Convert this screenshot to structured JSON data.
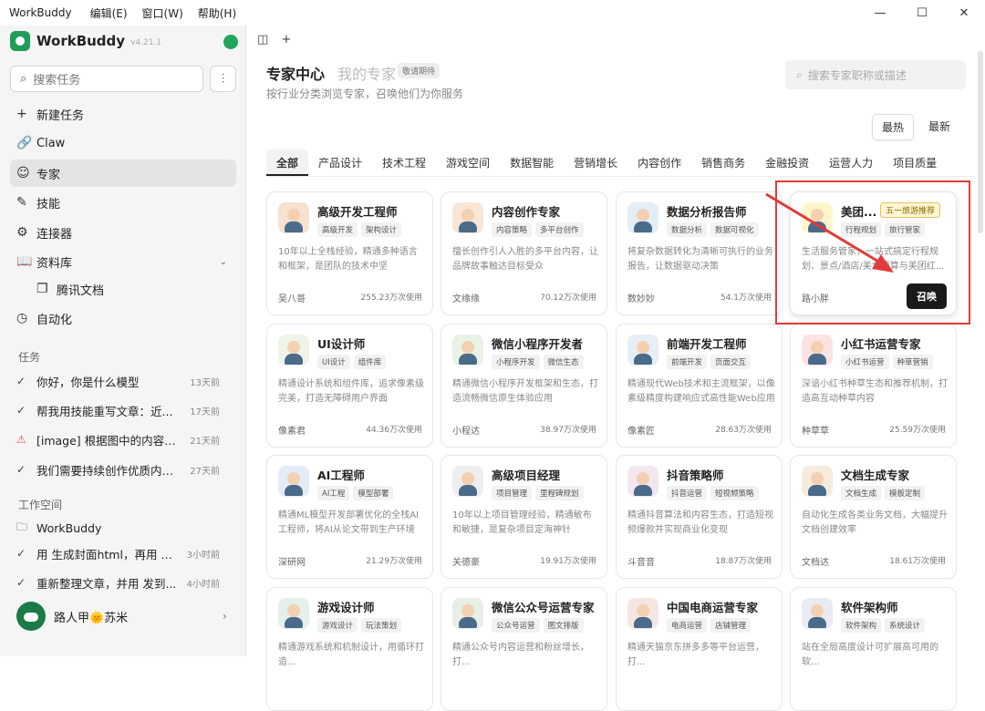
{
  "menubar": {
    "app": "WorkBuddy",
    "items": [
      "编辑(E)",
      "窗口(W)",
      "帮助(H)"
    ]
  },
  "window": {
    "min": "—",
    "max": "☐",
    "close": "✕"
  },
  "sidebar": {
    "brand": "WorkBuddy",
    "version": "v4.21.1",
    "search_placeholder": "搜索任务",
    "nav": [
      {
        "label": "新建任务",
        "icon": "+"
      },
      {
        "label": "Claw",
        "icon": "🔗"
      },
      {
        "label": "专家",
        "icon": "☺"
      },
      {
        "label": "技能",
        "icon": "✎"
      },
      {
        "label": "连接器",
        "icon": "⚙"
      },
      {
        "label": "资料库",
        "icon": "📖"
      },
      {
        "label": "腾讯文档",
        "icon": "❐"
      },
      {
        "label": "自动化",
        "icon": "◷"
      }
    ],
    "tasks_title": "任务",
    "tasks": [
      {
        "text": "你好，你是什么模型",
        "time": "13天前",
        "icon": "✓"
      },
      {
        "text": "帮我用技能重写文章：近...",
        "time": "17天前",
        "icon": "✓"
      },
      {
        "text": "[image] 根据图中的内容排...",
        "time": "21天前",
        "icon": "⚠"
      },
      {
        "text": "我们需要持续创作优质内容...",
        "time": "27天前",
        "icon": "✓"
      }
    ],
    "workspace_title": "工作空间",
    "workspace_folder": "WorkBuddy",
    "workspace_tasks": [
      {
        "text": "用 生成封面html，再用 转...",
        "time": "3小时前"
      },
      {
        "text": "重新整理文章，并用 发到...",
        "time": "4小时前"
      }
    ],
    "user": "路人甲🌞苏米"
  },
  "main": {
    "title": "专家中心",
    "title2": "我的专家",
    "soon": "敬请期待",
    "subtitle": "按行业分类浏览专家，召唤他们为你服务",
    "search_placeholder": "搜索专家职称或描述",
    "sort": [
      "最热",
      "最新"
    ],
    "categories": [
      "全部",
      "产品设计",
      "技术工程",
      "游戏空间",
      "数据智能",
      "营销增长",
      "内容创作",
      "销售商务",
      "金融投资",
      "运营人力",
      "项目质量"
    ],
    "summon_label": "召唤",
    "cards": [
      {
        "name": "高级开发工程师",
        "tags": [
          "高级开发",
          "架构设计"
        ],
        "desc": "10年以上全栈经验，精通多种语言和框架，是团队的技术中坚",
        "author": "吴八哥",
        "uses": "255.23万次使用",
        "color": "#f6e2cf"
      },
      {
        "name": "内容创作专家",
        "tags": [
          "内容策略",
          "多平台创作"
        ],
        "desc": "擅长创作引人入胜的多平台内容，让品牌故事触达目标受众",
        "author": "文缘缘",
        "uses": "70.12万次使用",
        "color": "#f8e6d6"
      },
      {
        "name": "数据分析报告师",
        "tags": [
          "数据分析",
          "数据可视化"
        ],
        "desc": "将复杂数据转化为清晰可执行的业务报告，让数据驱动决策",
        "author": "数妙妙",
        "uses": "54.1万次使用",
        "color": "#e3eef6"
      },
      {
        "name": "美团...",
        "tags": [
          "行程规划",
          "旅行管家"
        ],
        "badge": "五一旅游推荐",
        "desc": "生活服务管家，一站式搞定行程规划、景点/酒店/美食预算与美团红...",
        "author": "路小胖",
        "uses": "",
        "color": "#fff6cc",
        "summon": true
      },
      {
        "name": "UI设计师",
        "tags": [
          "UI设计",
          "组件库"
        ],
        "desc": "精通设计系统和组件库，追求像素级完美，打造无障碍用户界面",
        "author": "像素君",
        "uses": "44.36万次使用",
        "color": "#eef4e8"
      },
      {
        "name": "微信小程序开发者",
        "tags": [
          "小程序开发",
          "微信生态"
        ],
        "desc": "精通微信小程序开发框架和生态，打造流畅微信原生体验应用",
        "author": "小程达",
        "uses": "38.97万次使用",
        "color": "#e8f3e6"
      },
      {
        "name": "前端开发工程师",
        "tags": [
          "前端开发",
          "页面交互"
        ],
        "desc": "精通现代Web技术和主流框架，以像素级精度构建响应式高性能Web应用",
        "author": "像素匠",
        "uses": "28.63万次使用",
        "color": "#e6eef6"
      },
      {
        "name": "小红书运营专家",
        "tags": [
          "小红书运营",
          "种草营销"
        ],
        "desc": "深谙小红书种草生态和推荐机制，打造高互动种草内容",
        "author": "种草草",
        "uses": "25.59万次使用",
        "color": "#fbe3e3"
      },
      {
        "name": "AI工程师",
        "tags": [
          "AI工程",
          "模型部署"
        ],
        "desc": "精通ML模型开发部署优化的全栈AI工程师，将AI从论文带到生产环境",
        "author": "深研网",
        "uses": "21.29万次使用",
        "color": "#e3ecf6"
      },
      {
        "name": "高级项目经理",
        "tags": [
          "项目管理",
          "里程碑规划"
        ],
        "desc": "10年以上项目管理经验，精通敏布和敏捷，是复杂项目定海神针",
        "author": "关德豪",
        "uses": "19.91万次使用",
        "color": "#eeeeee"
      },
      {
        "name": "抖音策略师",
        "tags": [
          "抖音运营",
          "短视频策略"
        ],
        "desc": "精通抖音算法和内容生态，打造短视频爆款并实现商业化变现",
        "author": "斗音音",
        "uses": "18.87万次使用",
        "color": "#f3e6ef"
      },
      {
        "name": "文档生成专家",
        "tags": [
          "文档生成",
          "模板定制"
        ],
        "desc": "自动化生成各类业务文档，大幅提升文档创建效率",
        "author": "文档达",
        "uses": "18.61万次使用",
        "color": "#f6ecdd"
      },
      {
        "name": "游戏设计师",
        "tags": [
          "游戏设计",
          "玩法策划"
        ],
        "desc": "精通游戏系统和机制设计，用循环打造...",
        "author": "",
        "uses": "",
        "color": "#e6f0ea"
      },
      {
        "name": "微信公众号运营专家",
        "tags": [
          "公众号运营",
          "图文排版"
        ],
        "desc": "精通公众号内容运营和粉丝增长，打...",
        "author": "",
        "uses": "",
        "color": "#e8f0e6"
      },
      {
        "name": "中国电商运营专家",
        "tags": [
          "电商运营",
          "店铺管理"
        ],
        "desc": "精通天猫京东拼多多等平台运营，打...",
        "author": "",
        "uses": "",
        "color": "#f6e6e2"
      },
      {
        "name": "软件架构师",
        "tags": [
          "软件架构",
          "系统设计"
        ],
        "desc": "站在全局高度设计可扩展高可用的软...",
        "author": "",
        "uses": "",
        "color": "#eaeaf2"
      }
    ]
  }
}
